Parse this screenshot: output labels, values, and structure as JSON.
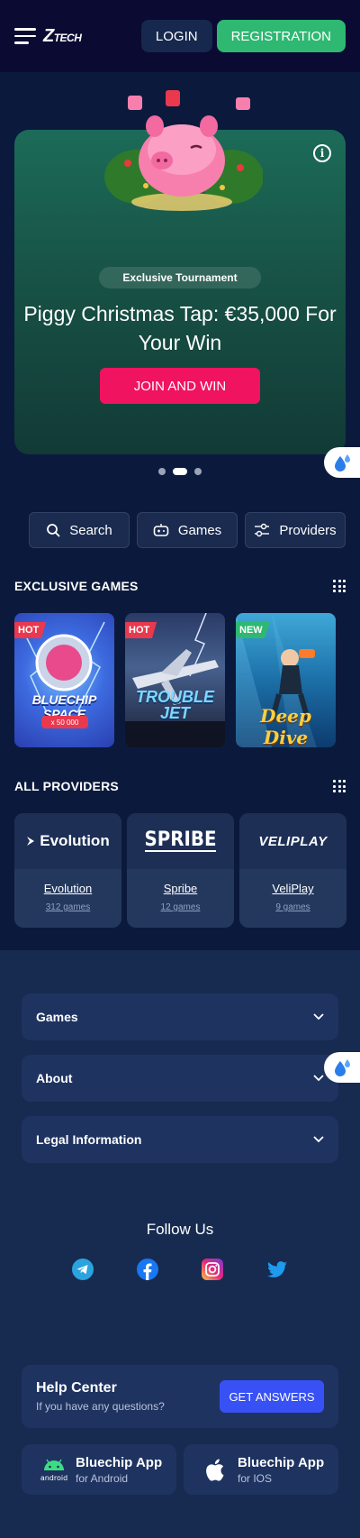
{
  "header": {
    "logo_main": "Z",
    "logo_sub": "TECH",
    "login_label": "LOGIN",
    "registration_label": "REGISTRATION"
  },
  "hero": {
    "tag": "Exclusive Tournament",
    "title": "Piggy Christmas Tap: €35,000 For Your Win",
    "cta_label": "JOIN AND WIN",
    "slides_total": 3,
    "active_slide": 2
  },
  "quicknav": [
    {
      "label": "Search",
      "icon": "search-icon"
    },
    {
      "label": "Games",
      "icon": "gamepad-icon"
    },
    {
      "label": "Providers",
      "icon": "sliders-icon"
    }
  ],
  "exclusive_games": {
    "heading": "EXCLUSIVE GAMES",
    "items": [
      {
        "badge": "HOT",
        "title": "BLUECHIP SPACE",
        "multiplier": "x 50 000",
        "badge_color": "#e8394f"
      },
      {
        "badge": "HOT",
        "title": "TROUBLE JET",
        "badge_color": "#e8394f"
      },
      {
        "badge": "NEW",
        "title": "Deep Dive",
        "badge_color": "#2eb872"
      }
    ]
  },
  "providers": {
    "heading": "ALL PROVIDERS",
    "items": [
      {
        "logo": "Evolution",
        "name": "Evolution",
        "count": "312 games"
      },
      {
        "logo": "SPRIBE",
        "name": "Spribe",
        "count": "12 games"
      },
      {
        "logo": "VELIPLAY",
        "name": "VeliPlay",
        "count": "9 games"
      }
    ]
  },
  "footer": {
    "accordions": [
      "Games",
      "About",
      "Legal Information"
    ],
    "follow_label": "Follow Us",
    "socials": [
      "telegram-icon",
      "facebook-icon",
      "instagram-icon",
      "twitter-icon"
    ],
    "help": {
      "title": "Help Center",
      "subtitle": "If you have any questions?",
      "cta": "GET ANSWERS"
    },
    "apps": [
      {
        "title": "Bluechip App",
        "subtitle": "for Android",
        "icon": "android-icon"
      },
      {
        "title": "Bluechip App",
        "subtitle": "for IOS",
        "icon": "apple-icon"
      }
    ]
  },
  "colors": {
    "header_bg": "#0b0a33",
    "page_bg": "#0b1a3c",
    "registration": "#2eb872",
    "join": "#f0135f",
    "get_answers": "#3751f5"
  }
}
